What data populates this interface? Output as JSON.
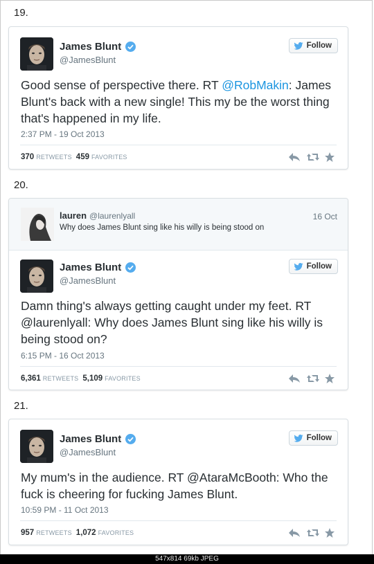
{
  "entries": [
    {
      "number": "19.",
      "tweet": {
        "name": "James Blunt",
        "handle": "@JamesBlunt",
        "follow_label": "Follow",
        "text_pre": "Good sense of perspective there. RT ",
        "text_mention": "@RobMakin",
        "text_post": ": James Blunt's back with a new single! This my be the worst thing that's happened in my life.",
        "time": "2:37 PM - 19 Oct 2013",
        "retweets": "370",
        "retweets_label": "RETWEETS",
        "favorites": "459",
        "favorites_label": "FAVORITES"
      }
    },
    {
      "number": "20.",
      "reply": {
        "name": "lauren",
        "handle": "@laurenlyall",
        "date": "16 Oct",
        "text": "Why does James Blunt sing like his willy is being stood on"
      },
      "tweet": {
        "name": "James Blunt",
        "handle": "@JamesBlunt",
        "follow_label": "Follow",
        "text": "Damn thing's always getting caught under my feet. RT @laurenlyall: Why does James Blunt sing like his willy is being stood on?",
        "time": "6:15 PM - 16 Oct 2013",
        "retweets": "6,361",
        "retweets_label": "RETWEETS",
        "favorites": "5,109",
        "favorites_label": "FAVORITES"
      }
    },
    {
      "number": "21.",
      "tweet": {
        "name": "James Blunt",
        "handle": "@JamesBlunt",
        "follow_label": "Follow",
        "text": "My mum's in the audience. RT @AtaraMcBooth: Who the fuck is cheering for fucking James Blunt.",
        "time": "10:59 PM - 11 Oct 2013",
        "retweets": "957",
        "retweets_label": "RETWEETS",
        "favorites": "1,072",
        "favorites_label": "FAVORITES"
      }
    }
  ],
  "image_info": "547x814  69kb  JPEG",
  "colors": {
    "link": "#1b95e0",
    "verified": "#55acee",
    "text": "#292f33",
    "muted": "#66757f"
  },
  "icons": [
    "verified-icon",
    "twitter-bird-icon",
    "reply-icon",
    "retweet-icon",
    "favorite-icon"
  ]
}
